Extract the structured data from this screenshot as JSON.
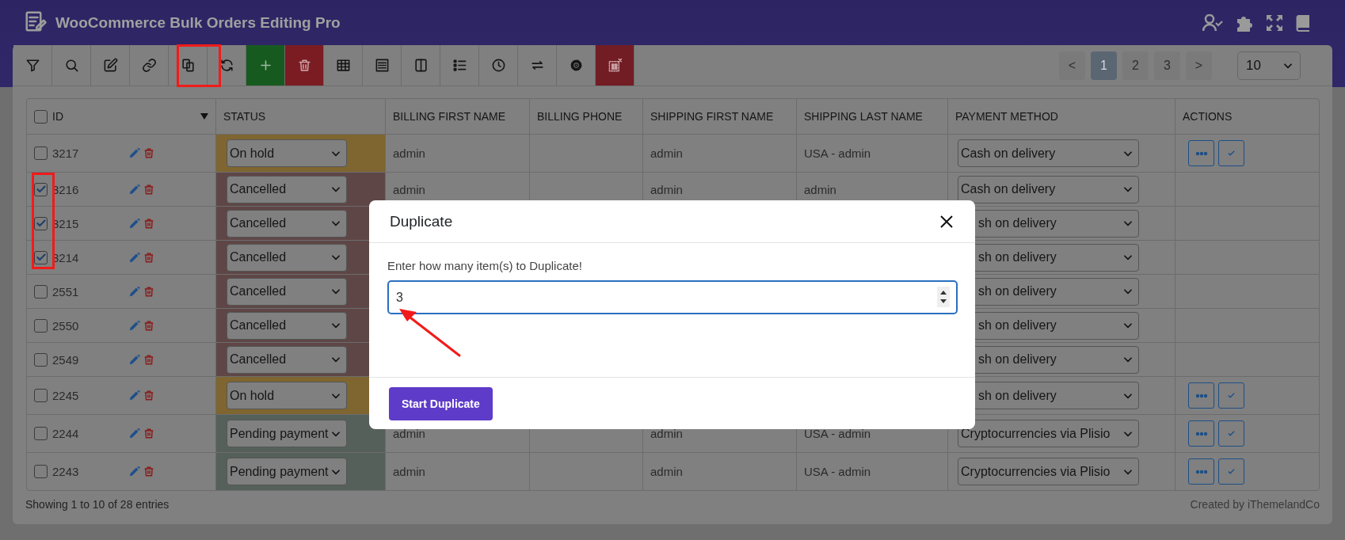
{
  "app": {
    "title": "WooCommerce Bulk Orders Editing Pro"
  },
  "pagination": {
    "pages": [
      {
        "label": "<",
        "selected": false
      },
      {
        "label": "1",
        "selected": true
      },
      {
        "label": "2",
        "selected": false
      },
      {
        "label": "3",
        "selected": false
      },
      {
        "label": ">",
        "selected": false
      }
    ],
    "per_page": "10"
  },
  "table": {
    "all_checked": false,
    "columns": [
      "ID",
      "STATUS",
      "BILLING FIRST NAME",
      "BILLING PHONE",
      "SHIPPING FIRST NAME",
      "SHIPPING LAST NAME",
      "PAYMENT METHOD",
      "ACTIONS"
    ],
    "rows": [
      {
        "kind": "full",
        "id": "3217",
        "checked": false,
        "status": "On hold",
        "color": "#7f6530",
        "billing_first_name": "admin",
        "shipping_first_name": "admin",
        "shipping_last_name": "USA - admin",
        "payment_method": "Cash on delivery",
        "has_actions": true
      },
      {
        "kind": "full",
        "id": "3216",
        "checked": true,
        "status": "Cancelled",
        "color": "#5f4646",
        "billing_first_name": "admin",
        "shipping_first_name": "admin",
        "shipping_last_name": "admin",
        "payment_method": "Cash on delivery",
        "has_actions": false
      },
      {
        "kind": "covered",
        "id": "3215",
        "checked": true,
        "status": "Cancelled",
        "color": "#5f4646",
        "payment_method": "sh on delivery",
        "has_actions": false
      },
      {
        "kind": "covered",
        "id": "3214",
        "checked": true,
        "status": "Cancelled",
        "color": "#5f4646",
        "payment_method": "sh on delivery",
        "has_actions": false
      },
      {
        "kind": "covered",
        "id": "2551",
        "checked": false,
        "status": "Cancelled",
        "color": "#5f4646",
        "payment_method": "sh on delivery",
        "has_actions": false
      },
      {
        "kind": "covered",
        "id": "2550",
        "checked": false,
        "status": "Cancelled",
        "color": "#5f4646",
        "payment_method": "sh on delivery",
        "has_actions": false
      },
      {
        "kind": "covered",
        "id": "2549",
        "checked": false,
        "status": "Cancelled",
        "color": "#5f4646",
        "payment_method": "sh on delivery",
        "has_actions": false
      },
      {
        "kind": "covered",
        "id": "2245",
        "checked": false,
        "status": "On hold",
        "color": "#7f6530",
        "payment_method": "sh on delivery",
        "has_actions": true
      },
      {
        "kind": "full",
        "id": "2244",
        "checked": false,
        "status": "Pending payment",
        "color": "#55605a",
        "billing_first_name": "admin",
        "shipping_first_name": "admin",
        "shipping_last_name": "USA - admin",
        "payment_method": "Cryptocurrencies via Plisio",
        "has_actions": true
      },
      {
        "kind": "full",
        "id": "2243",
        "checked": false,
        "status": "Pending payment",
        "color": "#55605a",
        "billing_first_name": "admin",
        "shipping_first_name": "admin",
        "shipping_last_name": "USA - admin",
        "payment_method": "Cryptocurrencies via Plisio",
        "has_actions": true
      }
    ]
  },
  "footer": {
    "info": "Showing 1 to 10 of 28 entries",
    "credit": "Created by iThemelandCo"
  },
  "modal": {
    "title": "Duplicate",
    "label": "Enter how many item(s) to Duplicate!",
    "value": "3",
    "button": "Start Duplicate"
  }
}
